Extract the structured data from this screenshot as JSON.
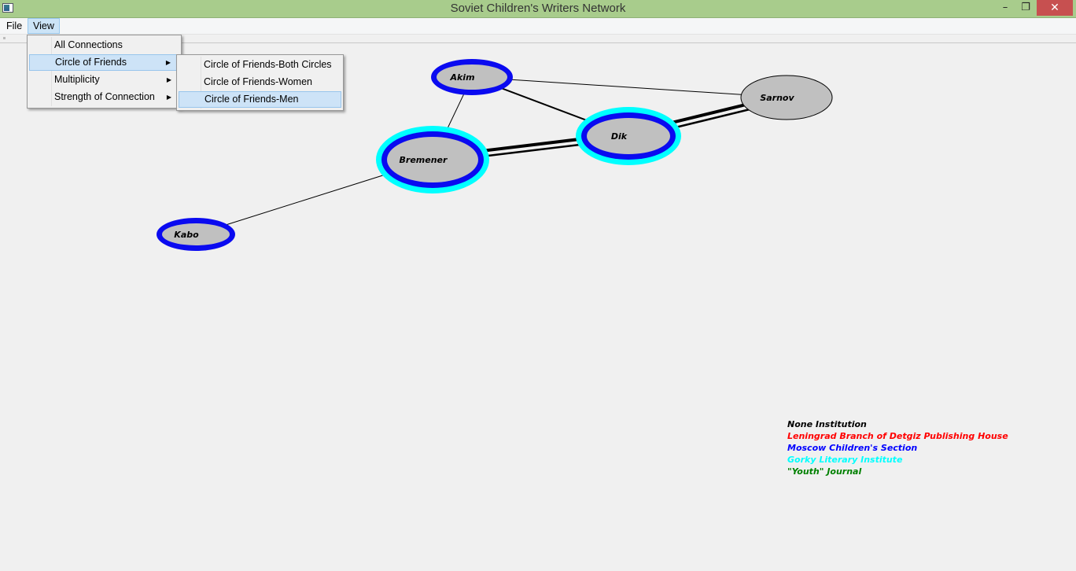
{
  "window": {
    "title": "Soviet Children's Writers Network",
    "minimize": "–",
    "maximize": "❐",
    "close": "✕"
  },
  "menubar": {
    "file": "File",
    "view": "View"
  },
  "view_menu": {
    "items": [
      {
        "label": "All Connections",
        "submenu": false
      },
      {
        "label": "Circle of Friends",
        "submenu": true,
        "highlighted": true
      },
      {
        "label": "Multiplicity",
        "submenu": true
      },
      {
        "label": "Strength of Connection",
        "submenu": true
      }
    ]
  },
  "circle_submenu": {
    "items": [
      {
        "label": "Circle of Friends-Both Circles"
      },
      {
        "label": "Circle of Friends-Women"
      },
      {
        "label": "Circle of Friends-Men",
        "highlighted": true
      }
    ]
  },
  "network": {
    "nodes": [
      {
        "id": "akim",
        "label": "Akim",
        "rings": [
          "#0a0af0"
        ]
      },
      {
        "id": "sarnov",
        "label": "Sarnov",
        "rings": []
      },
      {
        "id": "dik",
        "label": "Dik",
        "rings": [
          "#0a0af0",
          "#00ffff"
        ]
      },
      {
        "id": "bremener",
        "label": "Bremener",
        "rings": [
          "#0a0af0",
          "#00ffff"
        ]
      },
      {
        "id": "kabo",
        "label": "Kabo",
        "rings": [
          "#0a0af0"
        ]
      }
    ],
    "edges": [
      {
        "from": "akim",
        "to": "sarnov",
        "strength": 1
      },
      {
        "from": "akim",
        "to": "dik",
        "strength": 2
      },
      {
        "from": "akim",
        "to": "bremener",
        "strength": 1
      },
      {
        "from": "bremener",
        "to": "dik",
        "strength": 3
      },
      {
        "from": "dik",
        "to": "sarnov",
        "strength": 3
      },
      {
        "from": "bremener",
        "to": "kabo",
        "strength": 1
      }
    ]
  },
  "legend": [
    {
      "label": "None Institution",
      "color": "#000000"
    },
    {
      "label": "Leningrad Branch of Detgiz Publishing House",
      "color": "#ff0000"
    },
    {
      "label": "Moscow Children's Section",
      "color": "#0000ff"
    },
    {
      "label": "Gorky Literary Institute",
      "color": "#00ffff"
    },
    {
      "label": "\"Youth\" Journal",
      "color": "#008000"
    }
  ],
  "colors": {
    "node_fill": "#c0c0c0",
    "titlebar": "#a8cc8c"
  }
}
